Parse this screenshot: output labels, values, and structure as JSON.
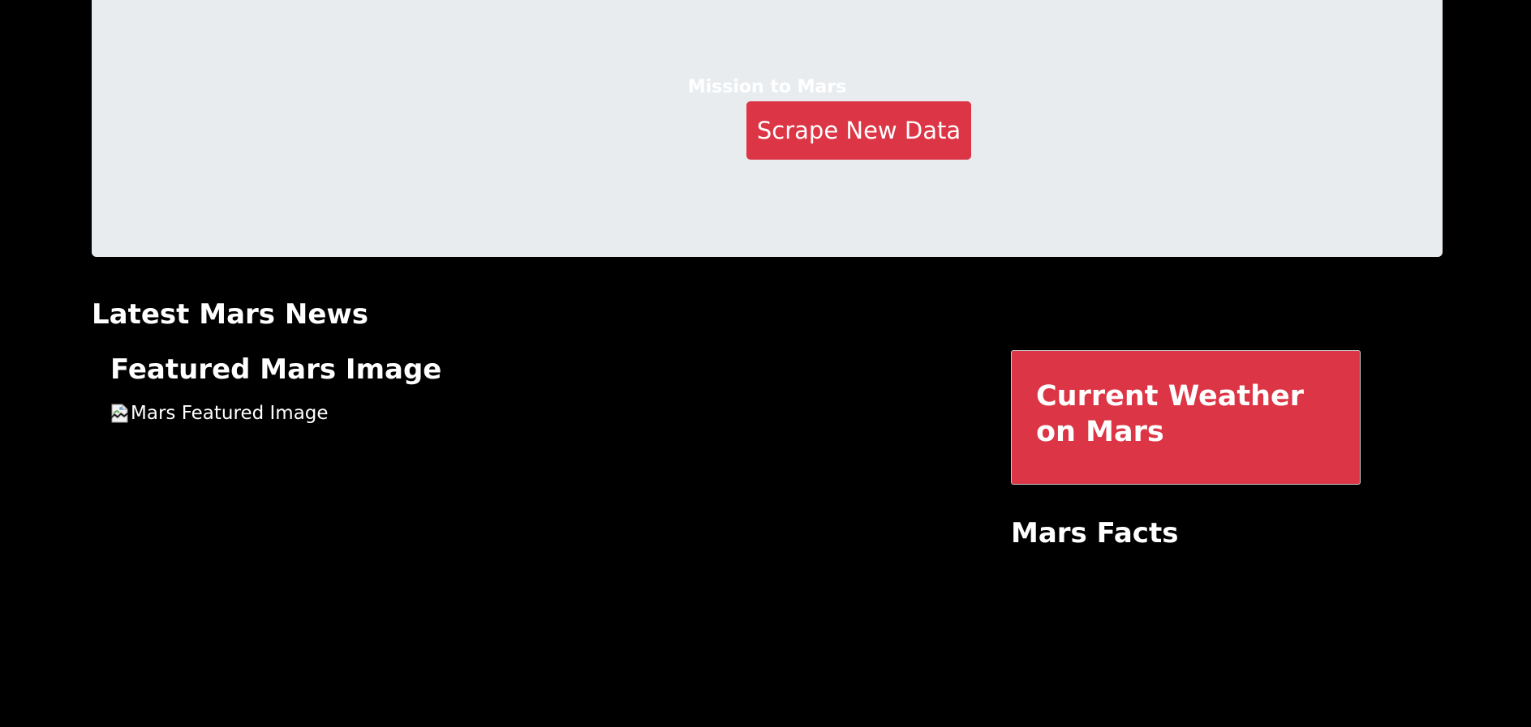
{
  "jumbotron": {
    "title": "Mission to Mars",
    "scrape_button_label": "Scrape New Data"
  },
  "news": {
    "heading": "Latest Mars News"
  },
  "featured_image": {
    "heading": "Featured Mars Image",
    "alt_text": "Mars Featured Image"
  },
  "weather": {
    "heading": "Current Weather on Mars"
  },
  "facts": {
    "heading": "Mars Facts"
  },
  "colors": {
    "page_background": "#000000",
    "jumbotron_background": "#e9ecef",
    "accent_red": "#dc3545",
    "text_white": "#ffffff"
  },
  "icons": {
    "featured_image_placeholder": "broken-image-icon"
  }
}
